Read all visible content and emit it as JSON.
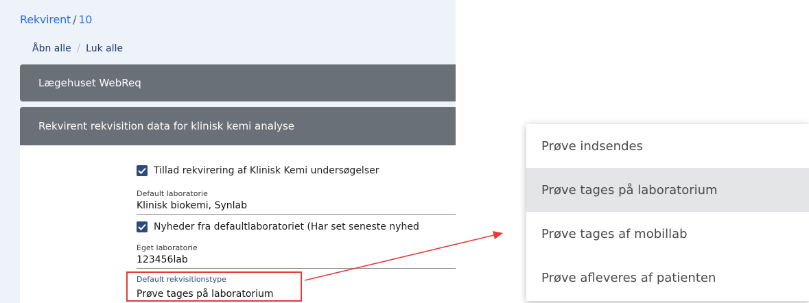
{
  "breadcrumb": {
    "parent": "Rekvirent",
    "separator": "/",
    "current": "10"
  },
  "toggles": {
    "open_all": "Åbn alle",
    "divider": "/",
    "close_all": "Luk alle"
  },
  "panels": [
    {
      "title": "Lægehuset WebReq"
    },
    {
      "title": "Rekvirent rekvisition data for klinisk kemi analyse"
    }
  ],
  "form": {
    "allow_checkbox": {
      "label": "Tillad rekvirering af Klinisk Kemi undersøgelser",
      "checked": true
    },
    "default_lab": {
      "label": "Default laboratorie",
      "value": "Klinisk biokemi, Synlab"
    },
    "news_checkbox": {
      "label": "Nyheder fra defaultlaboratoriet (Har set seneste nyhed",
      "checked": true
    },
    "own_lab": {
      "label": "Eget laboratorie",
      "value": "123456lab"
    },
    "default_type": {
      "label": "Default rekvisitionstype",
      "value": "Prøve tages på laboratorium"
    }
  },
  "dropdown": {
    "options": [
      "Prøve indsendes",
      "Prøve tages på laboratorium",
      "Prøve tages af mobillab",
      "Prøve afleveres af patienten"
    ],
    "selected_index": 1
  },
  "colors": {
    "highlight": "#e23b3b",
    "panel": "#6a7078",
    "checkbox": "#2c4a7c",
    "link": "#2f6fd6"
  }
}
